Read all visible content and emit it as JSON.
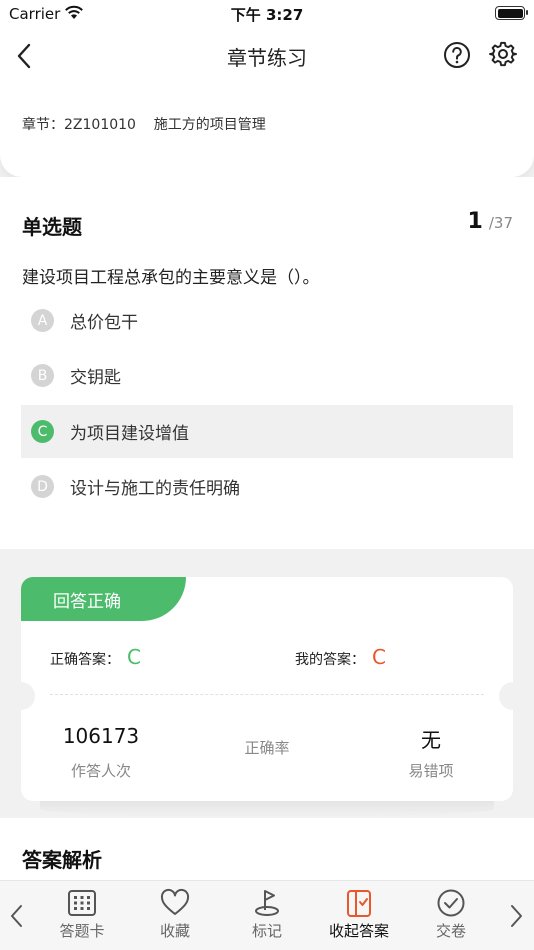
{
  "status_bar": {
    "carrier": "Carrier",
    "time": "下午 3:27"
  },
  "nav": {
    "title": "章节练习"
  },
  "chapter": {
    "label": "章节：",
    "code": "2Z101010",
    "name": "施工方的项目管理"
  },
  "question": {
    "type": "单选题",
    "current": "1",
    "total": "/37",
    "text": "建设项目工程总承包的主要意义是（）。",
    "options": [
      {
        "letter": "A",
        "text": "总价包干"
      },
      {
        "letter": "B",
        "text": "交钥匙"
      },
      {
        "letter": "C",
        "text": "为项目建设增值"
      },
      {
        "letter": "D",
        "text": "设计与施工的责任明确"
      }
    ],
    "selected": "C"
  },
  "result": {
    "banner": "回答正确",
    "correct_label": "正确答案：",
    "correct_value": "C",
    "my_label": "我的答案：",
    "my_value": "C",
    "attempts": "106173",
    "attempts_label": "作答人次",
    "accuracy_label": "正确率",
    "common_wrong": "无",
    "common_wrong_label": "易错项"
  },
  "analysis": {
    "heading": "答案解析"
  },
  "tabs": [
    {
      "label": "答题卡",
      "icon": "answer-sheet-icon"
    },
    {
      "label": "收藏",
      "icon": "heart-icon"
    },
    {
      "label": "标记",
      "icon": "flag-icon"
    },
    {
      "label": "收起答案",
      "icon": "collapse-answer-icon"
    },
    {
      "label": "交卷",
      "icon": "check-circle-icon"
    }
  ],
  "colors": {
    "accent_green": "#4cbc6c",
    "answer_correct": "#4cbc6c",
    "answer_mine": "#e8582c",
    "tab_active": "#e8582c"
  }
}
